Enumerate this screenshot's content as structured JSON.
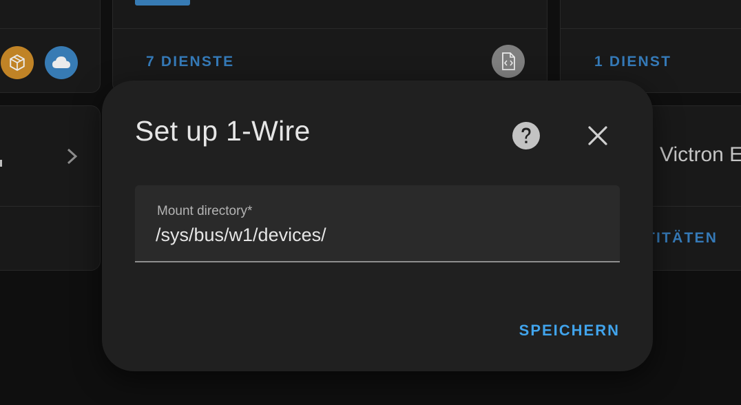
{
  "background": {
    "left_cards": {
      "chevron_icon": "chevron-right-icon"
    },
    "middle_card": {
      "footer_label": "7 DIENSTE",
      "file_icon": "file-code-icon"
    },
    "right_card": {
      "footer_label": "1 DIENST",
      "name_partial": "Victron E",
      "entities_partial": "TITÄTEN"
    },
    "chips": [
      {
        "icon": "package-icon",
        "color": "#d18f2a"
      },
      {
        "icon": "cloud-icon",
        "color": "#3c86c4"
      }
    ]
  },
  "dialog": {
    "title": "Set up 1-Wire",
    "help_icon": "help-circle-icon",
    "close_icon": "close-icon",
    "field": {
      "label": "Mount directory*",
      "value": "/sys/bus/w1/devices/"
    },
    "save_label": "SPEICHERN"
  },
  "colors": {
    "accent": "#41a4ec",
    "footer_link": "#3a85c8",
    "dialog_bg": "#202020",
    "page_bg": "#111111"
  }
}
